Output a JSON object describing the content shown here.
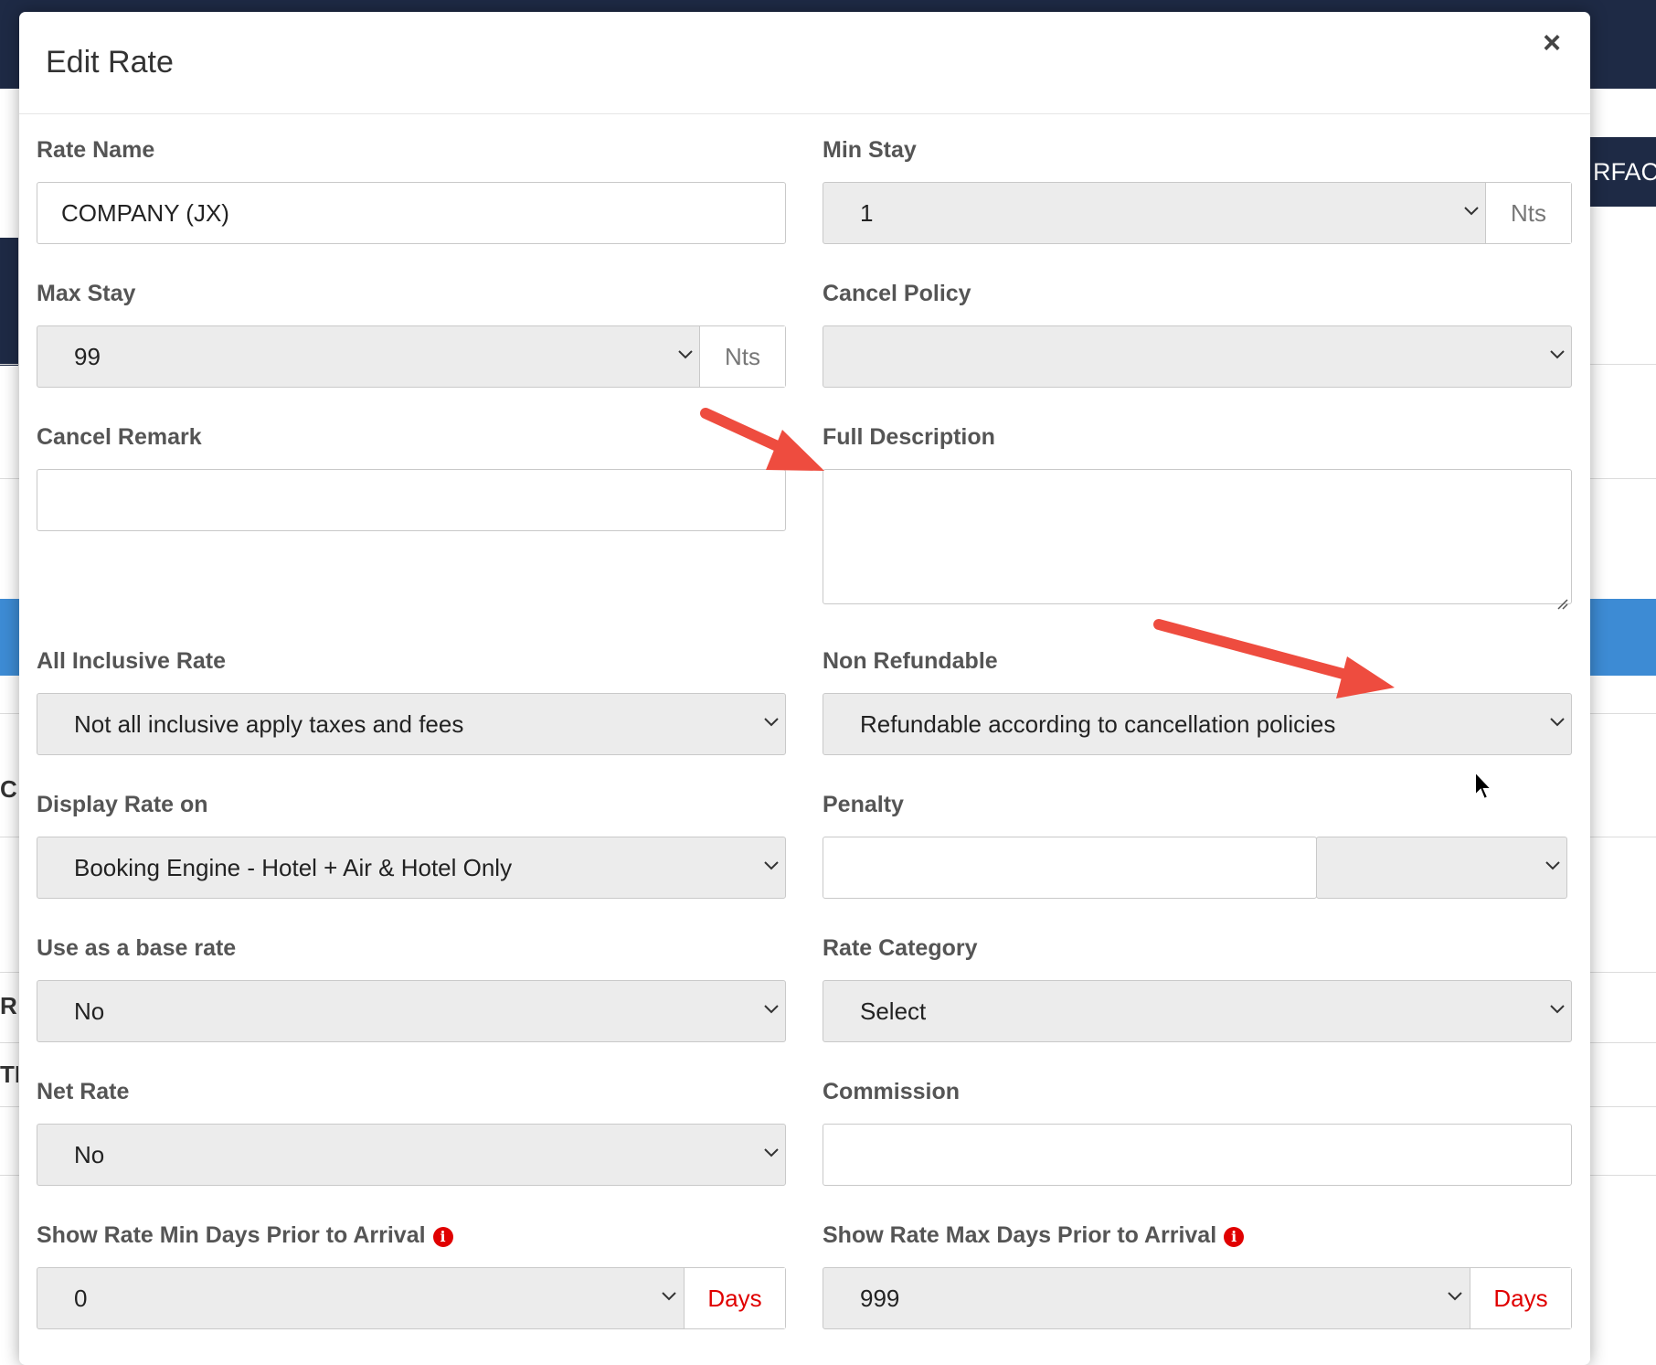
{
  "background": {
    "right_button_text": "RFACE",
    "edge_letters": [
      "C",
      "R",
      "TI"
    ]
  },
  "modal": {
    "title": "Edit Rate",
    "close_symbol": "×"
  },
  "fields": {
    "rate_name": {
      "label": "Rate Name",
      "value": "COMPANY (JX)"
    },
    "min_stay": {
      "label": "Min Stay",
      "value": "1",
      "unit": "Nts"
    },
    "max_stay": {
      "label": "Max Stay",
      "value": "99",
      "unit": "Nts"
    },
    "cancel_policy": {
      "label": "Cancel Policy",
      "value": ""
    },
    "cancel_remark": {
      "label": "Cancel Remark",
      "value": ""
    },
    "full_description": {
      "label": "Full Description",
      "value": ""
    },
    "all_inclusive_rate": {
      "label": "All Inclusive Rate",
      "value": "Not all inclusive apply taxes and fees"
    },
    "non_refundable": {
      "label": "Non Refundable",
      "value": "Refundable according to cancellation policies"
    },
    "display_rate_on": {
      "label": "Display Rate on",
      "value": "Booking Engine - Hotel + Air & Hotel Only"
    },
    "penalty": {
      "label": "Penalty",
      "value": "",
      "unit_value": ""
    },
    "use_as_base_rate": {
      "label": "Use as a base rate",
      "value": "No"
    },
    "rate_category": {
      "label": "Rate Category",
      "value": "Select"
    },
    "net_rate": {
      "label": "Net Rate",
      "value": "No"
    },
    "commission": {
      "label": "Commission",
      "value": ""
    },
    "show_rate_min_days": {
      "label": "Show Rate Min Days Prior to Arrival",
      "value": "0",
      "unit": "Days"
    },
    "show_rate_max_days": {
      "label": "Show Rate Max Days Prior to Arrival",
      "value": "999",
      "unit": "Days"
    }
  },
  "icons": {
    "chevron": "chevron-down-icon",
    "info": "info-icon",
    "close": "close-icon"
  },
  "colors": {
    "accent_red": "#e00000",
    "annotation_arrow": "#ee4c3f",
    "nav_dark": "#1e2a45",
    "band_blue": "#3d8bd4"
  }
}
